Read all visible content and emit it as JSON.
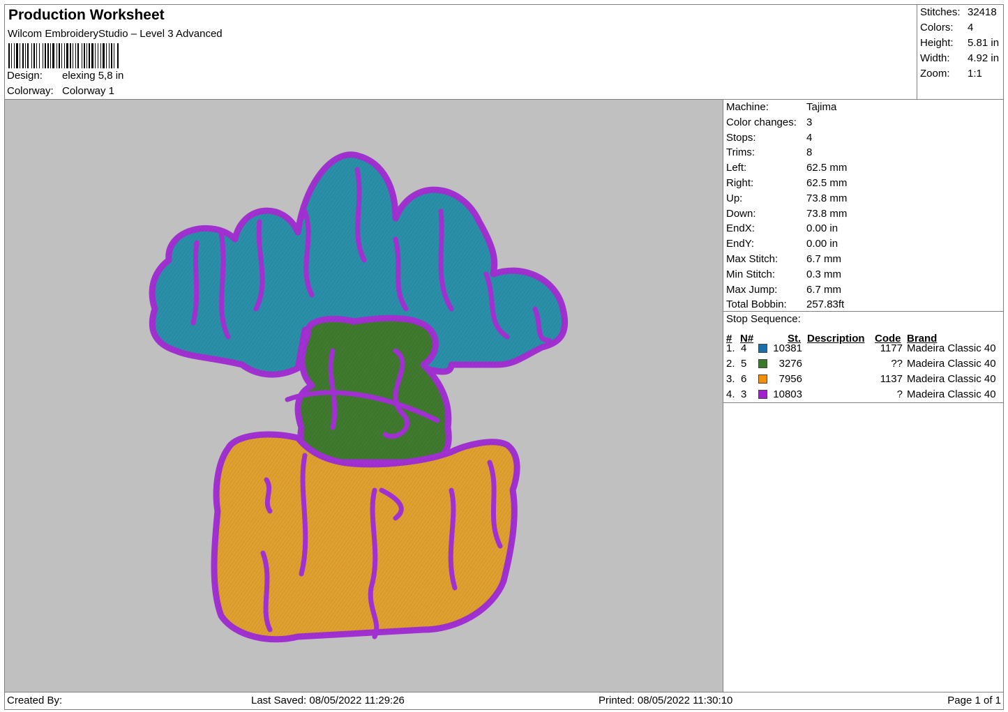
{
  "header": {
    "title": "Production Worksheet",
    "software": "Wilcom EmbroideryStudio – Level 3 Advanced",
    "design_label": "Design:",
    "design_value": "elexing 5,8 in",
    "colorway_label": "Colorway:",
    "colorway_value": "Colorway 1"
  },
  "summary": [
    {
      "label": "Stitches:",
      "value": "32418"
    },
    {
      "label": "Colors:",
      "value": "4"
    },
    {
      "label": "Height:",
      "value": "5.81 in"
    },
    {
      "label": "Width:",
      "value": "4.92 in"
    },
    {
      "label": "Zoom:",
      "value": "1:1"
    }
  ],
  "machine_info": [
    {
      "label": "Machine:",
      "value": "Tajima"
    },
    {
      "label": "Color changes:",
      "value": "3"
    },
    {
      "label": "Stops:",
      "value": "4"
    },
    {
      "label": "Trims:",
      "value": "8"
    },
    {
      "label": "Left:",
      "value": "62.5 mm"
    },
    {
      "label": "Right:",
      "value": "62.5 mm"
    },
    {
      "label": "Up:",
      "value": "73.8 mm"
    },
    {
      "label": "Down:",
      "value": "73.8 mm"
    },
    {
      "label": "EndX:",
      "value": "0.00 in"
    },
    {
      "label": "EndY:",
      "value": "0.00 in"
    },
    {
      "label": "Max Stitch:",
      "value": "6.7 mm"
    },
    {
      "label": "Min Stitch:",
      "value": "0.3 mm"
    },
    {
      "label": "Max Jump:",
      "value": "6.7 mm"
    },
    {
      "label": "Total Bobbin:",
      "value": "257.83ft"
    }
  ],
  "stop_sequence": {
    "title": "Stop Sequence:",
    "headers": {
      "num": "#",
      "n": "N#",
      "st": "St.",
      "description": "Description",
      "code": "Code",
      "brand": "Brand"
    },
    "rows": [
      {
        "num": "1.",
        "n": "4",
        "color": "#1a6fa8",
        "st": "10381",
        "code": "1177",
        "brand": "Madeira Classic 40"
      },
      {
        "num": "2.",
        "n": "5",
        "color": "#3a7a2a",
        "st": "3276",
        "code": "??",
        "brand": "Madeira Classic 40"
      },
      {
        "num": "3.",
        "n": "6",
        "color": "#f0900a",
        "st": "7956",
        "code": "1137",
        "brand": "Madeira Classic 40"
      },
      {
        "num": "4.",
        "n": "3",
        "color": "#a020d0",
        "st": "10803",
        "code": "?",
        "brand": "Madeira Classic 40"
      }
    ]
  },
  "footer": {
    "created_by": "Created By:",
    "last_saved": "Last Saved: 08/05/2022 11:29:26",
    "printed": "Printed: 08/05/2022 11:30:10",
    "page": "Page 1 of 1"
  },
  "colors": {
    "preview_bg": "#c0c0c0",
    "blue_fill": "#2a8fa8",
    "green_fill": "#3f7a2e",
    "orange_fill": "#e0a030",
    "purple_outline": "#a030d0"
  }
}
